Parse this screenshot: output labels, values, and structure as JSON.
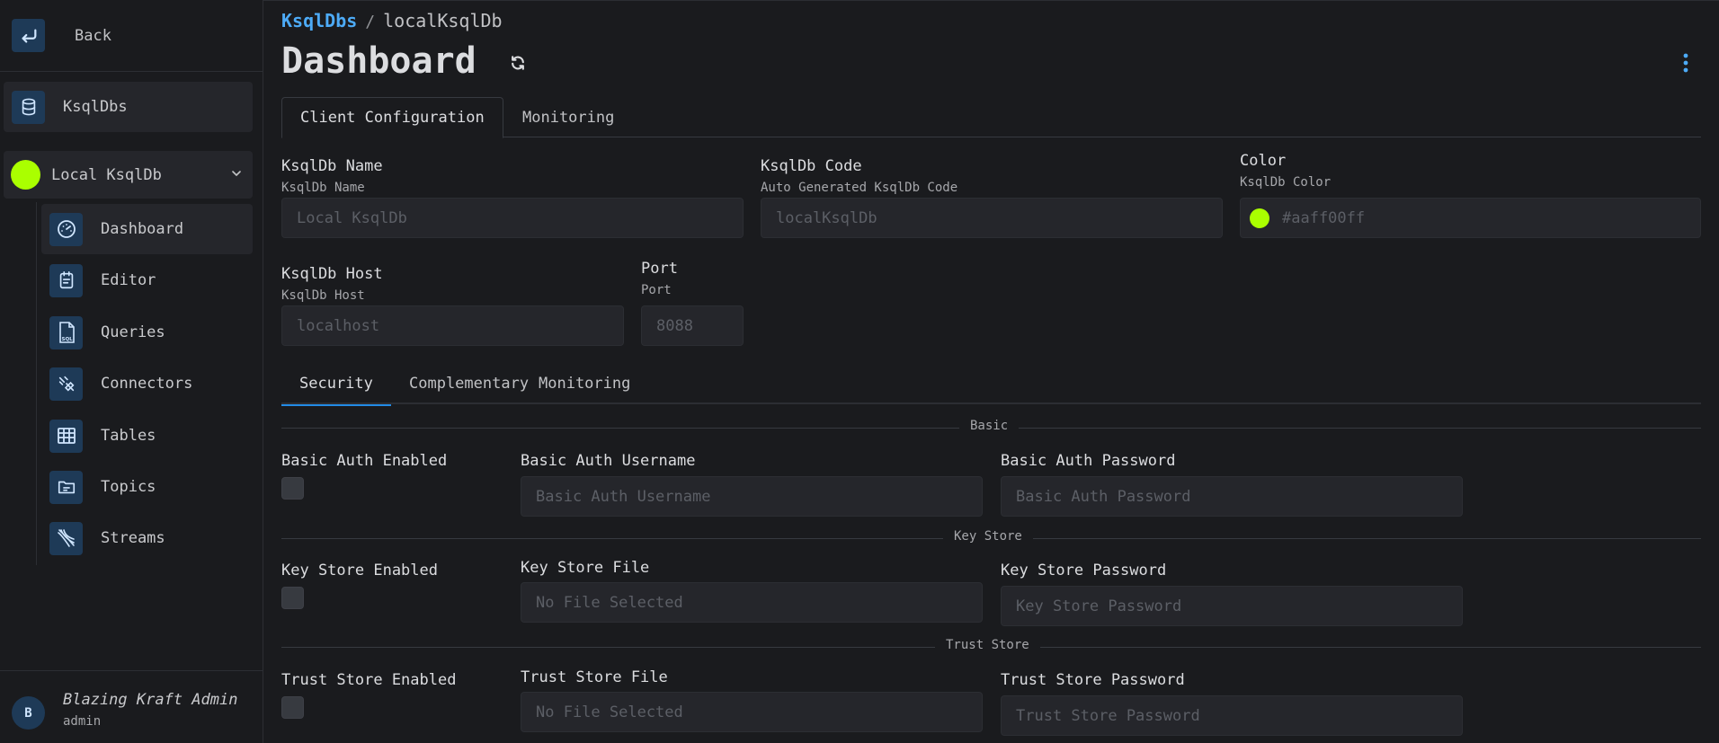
{
  "sidebar": {
    "back_label": "Back",
    "top_item": "KsqlDbs",
    "group": {
      "label": "Local KsqlDb",
      "color": "#aaff00"
    },
    "items": [
      {
        "label": "Dashboard",
        "icon": "dashboard-icon",
        "active": true
      },
      {
        "label": "Editor",
        "icon": "editor-icon"
      },
      {
        "label": "Queries",
        "icon": "sql-file-icon"
      },
      {
        "label": "Connectors",
        "icon": "connectors-icon"
      },
      {
        "label": "Tables",
        "icon": "table-icon"
      },
      {
        "label": "Topics",
        "icon": "topics-icon"
      },
      {
        "label": "Streams",
        "icon": "streams-icon"
      }
    ],
    "user": {
      "initial": "B",
      "name": "Blazing Kraft Admin",
      "role": "admin"
    }
  },
  "header": {
    "breadcrumb_link": "KsqlDbs",
    "breadcrumb_sep": "/",
    "breadcrumb_current": "localKsqlDb",
    "title": "Dashboard"
  },
  "tabs": [
    "Client Configuration",
    "Monitoring"
  ],
  "form": {
    "name": {
      "label": "KsqlDb Name",
      "desc": "KsqlDb Name",
      "value": "Local KsqlDb"
    },
    "code": {
      "label": "KsqlDb Code",
      "desc": "Auto Generated KsqlDb Code",
      "value": "localKsqlDb"
    },
    "color": {
      "label": "Color",
      "desc": "KsqlDb Color",
      "value": "#aaff00ff"
    },
    "host": {
      "label": "KsqlDb Host",
      "desc": "KsqlDb Host",
      "value": "localhost"
    },
    "port": {
      "label": "Port",
      "desc": "Port",
      "value": "8088"
    }
  },
  "sub_tabs": [
    "Security",
    "Complementary",
    "Monitoring"
  ],
  "security": {
    "basic": {
      "section": "Basic",
      "enabled_label": "Basic Auth Enabled",
      "username_label": "Basic Auth Username",
      "username_placeholder": "Basic Auth Username",
      "password_label": "Basic Auth Password",
      "password_placeholder": "Basic Auth Password"
    },
    "key_store": {
      "section": "Key Store",
      "enabled_label": "Key Store Enabled",
      "file_label": "Key Store File",
      "file_value": "No File Selected",
      "password_label": "Key Store Password",
      "password_placeholder": "Key Store Password"
    },
    "trust_store": {
      "section": "Trust Store",
      "enabled_label": "Trust Store Enabled",
      "file_label": "Trust Store File",
      "file_value": "No File Selected",
      "password_label": "Trust Store Password",
      "password_placeholder": "Trust Store Password"
    }
  }
}
